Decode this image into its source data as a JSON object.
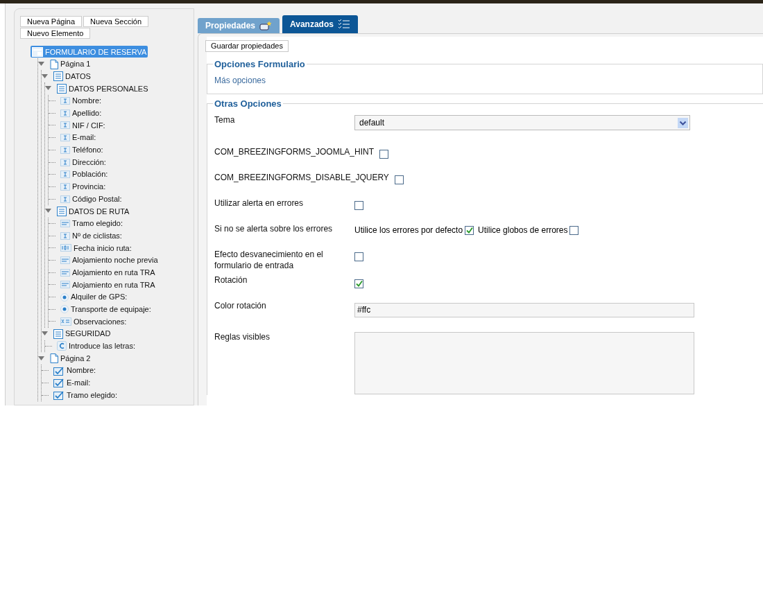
{
  "toolbar_buttons": [
    "Nueva Página",
    "Nueva Sección",
    "Nuevo Elemento"
  ],
  "tree": [
    {
      "label": "FORMULARIO DE RESERVA",
      "kind": "form",
      "selected": true,
      "children": [
        {
          "label": "Página 1",
          "kind": "page",
          "selected": false,
          "expanded": true,
          "children": [
            {
              "label": "DATOS",
              "kind": "section",
              "selected": false,
              "expanded": true,
              "children": [
                {
                  "label": "DATOS PERSONALES",
                  "kind": "section",
                  "selected": false,
                  "expanded": true,
                  "children": [
                    {
                      "label": "Nombre:",
                      "kind": "text",
                      "selected": false
                    },
                    {
                      "label": "Apellido:",
                      "kind": "text",
                      "selected": false
                    },
                    {
                      "label": "NIF / CIF:",
                      "kind": "text",
                      "selected": false
                    },
                    {
                      "label": "E-mail:",
                      "kind": "text",
                      "selected": false
                    },
                    {
                      "label": "Teléfono:",
                      "kind": "text",
                      "selected": false
                    },
                    {
                      "label": "Dirección:",
                      "kind": "text",
                      "selected": false
                    },
                    {
                      "label": "Población:",
                      "kind": "text",
                      "selected": false
                    },
                    {
                      "label": "Provincia:",
                      "kind": "text",
                      "selected": false
                    },
                    {
                      "label": "Código Postal:",
                      "kind": "text",
                      "selected": false
                    }
                  ]
                },
                {
                  "label": "DATOS DE RUTA",
                  "kind": "section",
                  "selected": false,
                  "expanded": true,
                  "children": [
                    {
                      "label": "Tramo elegido:",
                      "kind": "select",
                      "selected": false
                    },
                    {
                      "label": "Nº de ciclistas:",
                      "kind": "text",
                      "selected": false
                    },
                    {
                      "label": "Fecha inicio ruta:",
                      "kind": "date",
                      "selected": false
                    },
                    {
                      "label": "Alojamiento noche previa",
                      "kind": "select",
                      "selected": false
                    },
                    {
                      "label": "Alojamiento en ruta TRA",
                      "kind": "select",
                      "selected": false
                    },
                    {
                      "label": "Alojamiento en ruta TRA",
                      "kind": "select",
                      "selected": false
                    },
                    {
                      "label": "Alquiler de GPS:",
                      "kind": "radio",
                      "selected": false
                    },
                    {
                      "label": "Transporte de equipaje:",
                      "kind": "radio",
                      "selected": false
                    },
                    {
                      "label": "Observaciones:",
                      "kind": "textarea",
                      "selected": false
                    }
                  ]
                }
              ]
            },
            {
              "label": "SEGURIDAD",
              "kind": "section",
              "selected": false,
              "expanded": true,
              "children": [
                {
                  "label": "Introduce las letras:",
                  "kind": "captcha",
                  "selected": false
                }
              ]
            }
          ]
        },
        {
          "label": "Página 2",
          "kind": "page",
          "selected": false,
          "expanded": true,
          "children": [
            {
              "label": "Nombre:",
              "kind": "check",
              "selected": false
            },
            {
              "label": "E-mail:",
              "kind": "check",
              "selected": false
            },
            {
              "label": "Tramo elegido:",
              "kind": "check",
              "selected": false
            }
          ]
        }
      ]
    }
  ],
  "tabs": [
    {
      "label": "Propiedades",
      "selected": false
    },
    {
      "label": "Avanzados",
      "selected": true
    }
  ],
  "save_button": "Guardar propiedades",
  "form_options": {
    "title": "Opciones Formulario",
    "link": "Más opciones"
  },
  "other_options": {
    "title": "Otras Opciones",
    "rows": [
      {
        "kind": "select",
        "label": "Tema",
        "value": "default"
      },
      {
        "kind": "checkbox",
        "label": "COM_BREEZINGFORMS_JOOMLA_HINT",
        "checked": false
      },
      {
        "kind": "checkbox",
        "label": "COM_BREEZINGFORMS_DISABLE_JQUERY",
        "checked": false
      },
      {
        "kind": "checkbox",
        "label": "Utilizar alerta en errores",
        "checked": false
      },
      {
        "kind": "choices",
        "label": "Si no se alerta sobre los errores",
        "options": [
          {
            "label": "Utilice los errores por defecto",
            "checked": true
          },
          {
            "label": "Utilice globos de errores",
            "checked": false
          }
        ]
      },
      {
        "kind": "checkbox",
        "label": "Efecto desvanecimiento en el formulario de entrada",
        "checked": false
      },
      {
        "kind": "checkbox",
        "label": "Rotación",
        "checked": true
      },
      {
        "kind": "text",
        "label": "Color rotación",
        "value": "#ffc"
      },
      {
        "kind": "textarea",
        "label": "Reglas visibles"
      }
    ]
  }
}
